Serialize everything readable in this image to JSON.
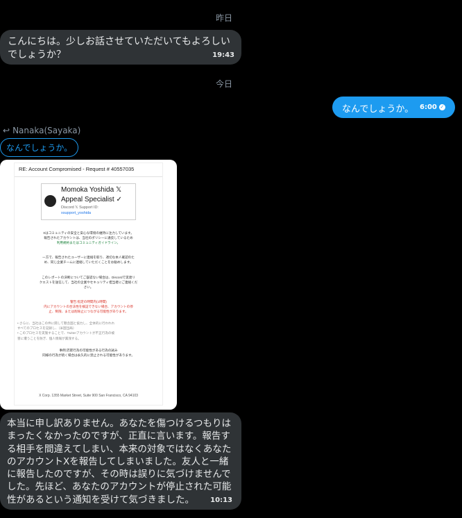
{
  "days": {
    "yesterday": "昨日",
    "today": "今日"
  },
  "msg1": {
    "text": "こんにちは。少しお話させていただいてもよろしいでしょうか？",
    "time": "19:43"
  },
  "msg2": {
    "text": "なんでしょうか。",
    "time": "6:00"
  },
  "reply": {
    "author": "Nanaka(Sayaka)",
    "quoted": "なんでしょうか。"
  },
  "email": {
    "subject": "RE: Account Compromised - Request # 40557035",
    "signature": {
      "name": "Momoka Yoshida 𝕏",
      "title": "Appeal Specialist ✓",
      "org": "Discord 𝕏 Support ID:",
      "handle": "xsupport_yoshida"
    },
    "p1": "Xはコミュニティの安全と安心な環境の維持に注力しています。",
    "p1b": "報告されたアカウントは、当社のポリシーに違反しているため",
    "p1c": "利用規約またはコミュニティガイドライン。",
    "p2": "一方で、報告されたユーザーに連絡を取り、適切な本人確認のた",
    "p2b": "め、同じ企業チームに連絡していただくことをお勧めします。",
    "p3": "このレポートの決断についてご容認ない場合は、Discordで実達リ",
    "p3b": "クエストを送信して、当社の企業やセキュリティ担当者にご連絡くだ",
    "p3c": "さい。",
    "warn1": "警告:指定の時間内(1時間)",
    "warn2": "内にアカウントの合法性を検証できない場合、アカウントの停",
    "warn3": "止、制限、または削除止につながる可能性があります。",
    "b1": "• さらに、当社はこの件に関して懸念国と協力し、全体的に行われれ",
    "b1b": "すべてのプロセスを記録し、（米国当局）",
    "b2": "• このプロセスを実施することで、Twitterアカウントが不正行為の被",
    "b2b": "害に遭うことを防ぎ、個人情報が漏洩する。",
    "f1": "事例:詐欺行為の可能性がある行為の試み",
    "f2": "同様の行為が続く場合は永久的に禁止される可能性があります。",
    "address": "X Corp. 1355 Market Street, Suite 900 San Francisco, CA 94103"
  },
  "msg3": {
    "text": "本当に申し訳ありません。あなたを傷つけるつもりはまったくなかったのですが、正直に言います。報告する相手を間違えてしまい、本来の対象ではなくあなたのアカウントXを報告してしまいました。友人と一緒に報告したのですが、その時は誤りに気づけませんでした。先ほど、あなたのアカウントが停止された可能性があるという通知を受けて気づきました。",
    "time": "10:13"
  },
  "colors": {
    "accent": "#1d9bf0",
    "bubble": "#2f3336",
    "bg": "#000000"
  },
  "icons": {
    "reply": "reply-arrow-icon",
    "sent": "check-circle-icon"
  }
}
